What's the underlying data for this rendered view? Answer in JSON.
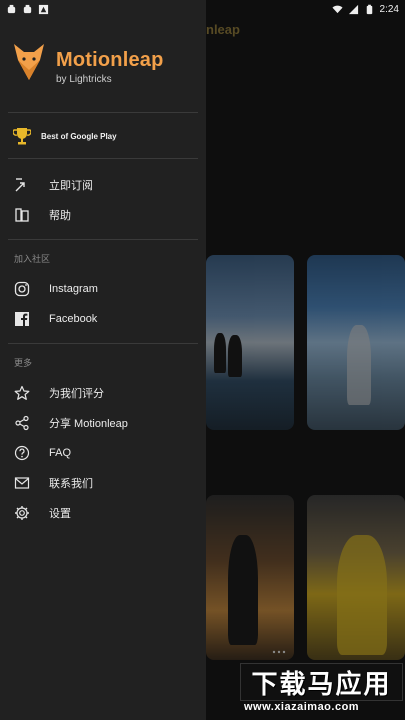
{
  "status_bar": {
    "time": "2:24"
  },
  "background": {
    "app_title_partial": "nleap"
  },
  "drawer": {
    "brand": {
      "name": "Motionleap",
      "subtitle": "by Lightricks",
      "accent_color": "#f2a04a"
    },
    "award": {
      "label": "Best of Google Play",
      "icon": "trophy-icon"
    },
    "main_items": [
      {
        "label": "立即订阅",
        "icon": "subscribe-icon"
      },
      {
        "label": "帮助",
        "icon": "book-icon"
      }
    ],
    "community_section": {
      "header": "加入社区",
      "items": [
        {
          "label": "Instagram",
          "icon": "instagram-icon"
        },
        {
          "label": "Facebook",
          "icon": "facebook-icon"
        }
      ]
    },
    "more_section": {
      "header": "更多",
      "items": [
        {
          "label": "为我们评分",
          "icon": "star-icon"
        },
        {
          "label": "分享 Motionleap",
          "icon": "share-icon"
        },
        {
          "label": "FAQ",
          "icon": "help-circle-icon"
        },
        {
          "label": "联系我们",
          "icon": "mail-icon"
        },
        {
          "label": "设置",
          "icon": "gear-icon"
        }
      ]
    }
  },
  "watermark": {
    "text": "下载马应用",
    "url": "www.xiazaimao.com"
  }
}
